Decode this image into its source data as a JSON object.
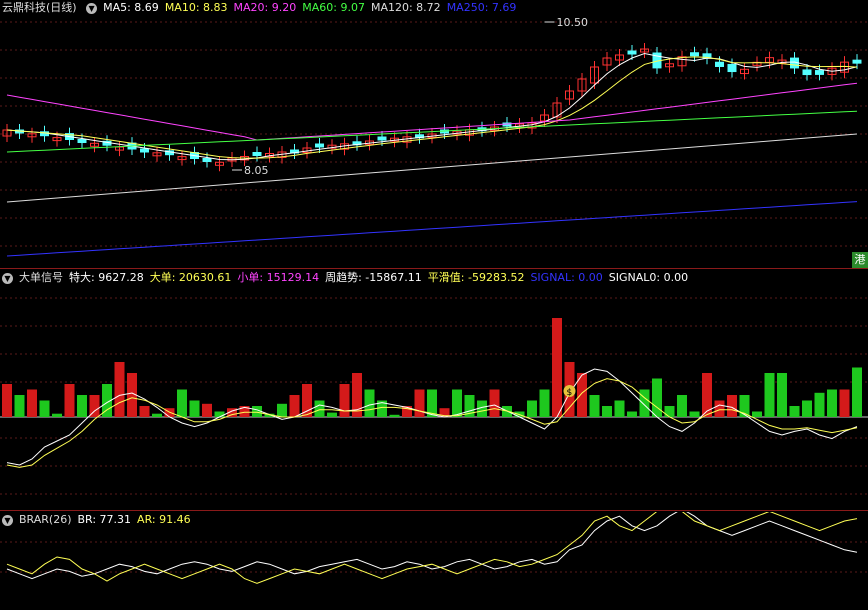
{
  "main": {
    "stock_name": "云鼎科技",
    "period": "(日线)",
    "ma": [
      {
        "label": "MA5: 8.69",
        "color": "#ffffff"
      },
      {
        "label": "MA10: 8.83",
        "color": "#ffff55"
      },
      {
        "label": "MA20: 9.20",
        "color": "#ff44ff"
      },
      {
        "label": "MA60: 9.07",
        "color": "#44ff44"
      },
      {
        "label": "MA120: 8.72",
        "color": "#dddddd"
      },
      {
        "label": "MA250: 7.69",
        "color": "#3333ff"
      }
    ],
    "high_marker": "10.50",
    "low_marker": "8.05",
    "badge": "港"
  },
  "ind1": {
    "name": "大单信号",
    "fields": [
      {
        "label": "特大: 9627.28",
        "color": "#ffffff"
      },
      {
        "label": "大单: 20630.61",
        "color": "#ffff55"
      },
      {
        "label": "小单: 15129.14",
        "color": "#ff44ff"
      },
      {
        "label": "周趋势: -15867.11",
        "color": "#ffffff"
      },
      {
        "label": "平滑值: -59283.52",
        "color": "#ffff55"
      },
      {
        "label": "SIGNAL: 0.00",
        "color": "#3333ff"
      },
      {
        "label": "SIGNAL0: 0.00",
        "color": "#ffffff"
      }
    ],
    "bars": [
      30,
      -20,
      25,
      -15,
      -3,
      30,
      -20,
      20,
      -30,
      50,
      40,
      10,
      -3,
      8,
      -25,
      -15,
      12,
      -5,
      8,
      10,
      -10,
      -3,
      -12,
      20,
      30,
      -15,
      -4,
      30,
      40,
      -25,
      -15,
      -2,
      10,
      25,
      -25,
      8,
      -25,
      -20,
      -15,
      25,
      -10,
      -5,
      -15,
      -25,
      90,
      50,
      40,
      -20,
      -10,
      -15,
      -5,
      -25,
      -35,
      -10,
      -20,
      -5,
      40,
      15,
      20,
      -20,
      -5,
      -40,
      -40,
      -10,
      -15,
      -22,
      -25,
      25,
      -45
    ],
    "white_line": [
      -38,
      -40,
      -35,
      -25,
      -20,
      -15,
      -5,
      5,
      12,
      18,
      20,
      15,
      8,
      0,
      -5,
      -8,
      -5,
      0,
      5,
      8,
      6,
      2,
      -2,
      0,
      5,
      10,
      8,
      5,
      6,
      10,
      12,
      10,
      8,
      5,
      2,
      0,
      2,
      5,
      8,
      10,
      5,
      0,
      -5,
      -10,
      0,
      20,
      35,
      40,
      38,
      30,
      20,
      10,
      0,
      -8,
      -12,
      -5,
      5,
      10,
      8,
      2,
      -5,
      -12,
      -15,
      -12,
      -10,
      -15,
      -18,
      -12,
      -8
    ],
    "yellow_line": [
      -40,
      -42,
      -40,
      -32,
      -26,
      -20,
      -12,
      -2,
      6,
      12,
      16,
      14,
      10,
      4,
      0,
      -4,
      -4,
      -2,
      2,
      4,
      4,
      2,
      0,
      0,
      2,
      6,
      6,
      5,
      5,
      6,
      8,
      8,
      7,
      5,
      3,
      1,
      1,
      3,
      5,
      7,
      5,
      2,
      -2,
      -6,
      -4,
      8,
      20,
      28,
      32,
      30,
      25,
      16,
      8,
      0,
      -5,
      -4,
      2,
      6,
      6,
      3,
      -2,
      -7,
      -10,
      -10,
      -9,
      -11,
      -13,
      -11,
      -9
    ],
    "signal_label": "$"
  },
  "ind2": {
    "name": "BRAR(26)",
    "fields": [
      {
        "label": "BR: 77.31",
        "color": "#ffffff"
      },
      {
        "label": "AR: 91.46",
        "color": "#ffff55"
      }
    ],
    "br": [
      70,
      68,
      66,
      68,
      70,
      69,
      67,
      68,
      70,
      72,
      71,
      69,
      68,
      70,
      72,
      73,
      72,
      70,
      69,
      71,
      73,
      72,
      70,
      68,
      69,
      71,
      72,
      73,
      74,
      72,
      70,
      71,
      73,
      72,
      70,
      71,
      73,
      74,
      72,
      70,
      71,
      73,
      74,
      72,
      73,
      78,
      80,
      86,
      90,
      92,
      88,
      86,
      88,
      92,
      95,
      92,
      88,
      86,
      84,
      86,
      88,
      90,
      88,
      86,
      84,
      82,
      80,
      78,
      77
    ],
    "ar": [
      72,
      70,
      68,
      72,
      75,
      74,
      70,
      68,
      65,
      68,
      70,
      72,
      70,
      68,
      66,
      68,
      70,
      72,
      70,
      66,
      64,
      66,
      68,
      70,
      69,
      68,
      70,
      72,
      70,
      68,
      66,
      68,
      70,
      71,
      72,
      70,
      68,
      70,
      72,
      74,
      73,
      71,
      72,
      74,
      76,
      80,
      84,
      90,
      92,
      88,
      86,
      90,
      94,
      96,
      94,
      90,
      88,
      86,
      88,
      90,
      92,
      94,
      92,
      90,
      88,
      86,
      88,
      90,
      91
    ]
  }
}
